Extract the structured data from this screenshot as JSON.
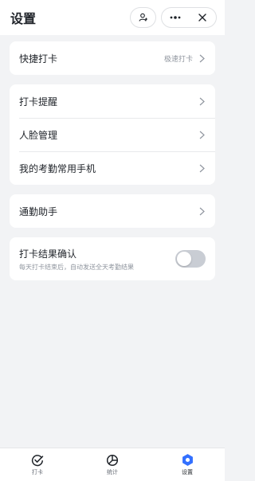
{
  "header": {
    "title": "设置",
    "icons": [
      "add-user-icon",
      "more-icon",
      "close-icon"
    ]
  },
  "quick": {
    "label": "快捷打卡",
    "value": "极速打卡"
  },
  "group1": {
    "items": [
      {
        "label": "打卡提醒"
      },
      {
        "label": "人脸管理"
      },
      {
        "label": "我的考勤常用手机"
      }
    ]
  },
  "assistant": {
    "label": "通勤助手"
  },
  "confirm": {
    "label": "打卡结果确认",
    "sublabel": "每天打卡结束后，自动发送全天考勤结果",
    "enabled": false
  },
  "tabs": [
    {
      "label": "打卡",
      "icon": "check-circle-icon",
      "active": false
    },
    {
      "label": "统计",
      "icon": "pie-chart-icon",
      "active": false
    },
    {
      "label": "设置",
      "icon": "gear-icon",
      "active": true
    }
  ],
  "colors": {
    "accent": "#3370ff",
    "background": "#f2f3f5",
    "toggle_off": "#c9cdd4"
  }
}
